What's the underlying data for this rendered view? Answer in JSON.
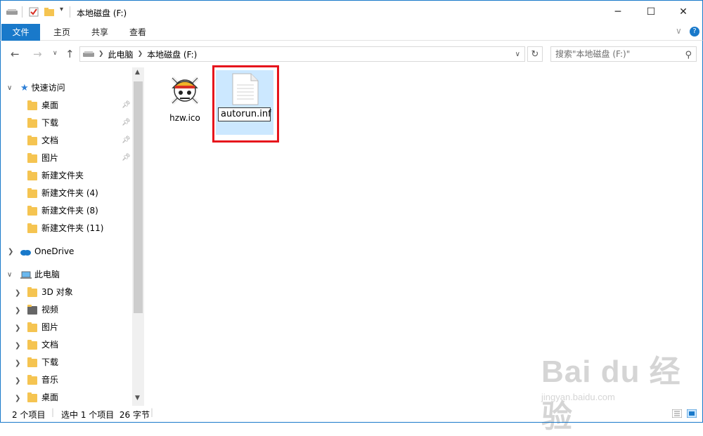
{
  "window": {
    "title": "本地磁盘 (F:)",
    "minimize": "─",
    "maximize": "☐",
    "close": "✕"
  },
  "ribbon": {
    "tabs": [
      {
        "label": "文件"
      },
      {
        "label": "主页"
      },
      {
        "label": "共享"
      },
      {
        "label": "查看"
      }
    ],
    "expand": "∨",
    "help": "?"
  },
  "address": {
    "segments": [
      "此电脑",
      "本地磁盘 (F:)"
    ],
    "search_placeholder": "搜索\"本地磁盘 (F:)\""
  },
  "nav": {
    "quick_access": "快速访问",
    "quick_items": [
      {
        "label": "桌面"
      },
      {
        "label": "下载"
      },
      {
        "label": "文档"
      },
      {
        "label": "图片"
      },
      {
        "label": "新建文件夹"
      },
      {
        "label": "新建文件夹 (4)"
      },
      {
        "label": "新建文件夹 (8)"
      },
      {
        "label": "新建文件夹 (11)"
      }
    ],
    "onedrive": "OneDrive",
    "this_pc": "此电脑",
    "pc_items": [
      {
        "label": "3D 对象"
      },
      {
        "label": "视频"
      },
      {
        "label": "图片"
      },
      {
        "label": "文档"
      },
      {
        "label": "下载"
      },
      {
        "label": "音乐"
      },
      {
        "label": "桌面"
      }
    ]
  },
  "files": [
    {
      "name": "hzw.ico"
    },
    {
      "name": "autorun.inf"
    }
  ],
  "status": {
    "count": "2 个项目",
    "selected": "选中 1 个项目  26 字节"
  },
  "watermark": {
    "logo": "Bai du 经验",
    "url": "jingyan.baidu.com"
  }
}
